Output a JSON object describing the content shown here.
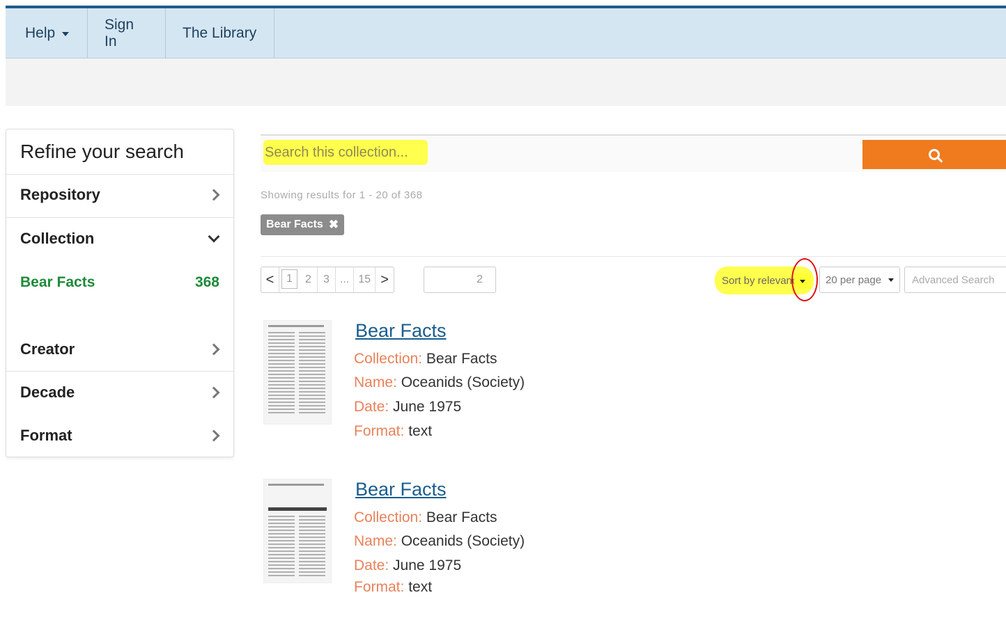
{
  "nav": {
    "help": "Help",
    "signin": "Sign In",
    "library": "The Library"
  },
  "sidebar": {
    "title": "Refine your search",
    "facets": [
      {
        "label": "Repository",
        "icon": "chevron-right-icon"
      },
      {
        "label": "Collection",
        "icon": "chevron-down-icon"
      },
      {
        "label": "Creator",
        "icon": "chevron-right-icon"
      },
      {
        "label": "Decade",
        "icon": "chevron-right-icon"
      },
      {
        "label": "Format",
        "icon": "chevron-right-icon"
      }
    ],
    "selected_value": {
      "label": "Bear Facts",
      "count": "368"
    }
  },
  "search": {
    "placeholder": "Search this collection...",
    "button_icon": "search-icon"
  },
  "results_summary": "Showing results for 1 - 20 of 368",
  "active_filter": {
    "label": "Bear Facts",
    "remove_icon": "close-icon"
  },
  "pagination": {
    "prev": "<",
    "pages": [
      "1",
      "2",
      "3",
      "...",
      "15"
    ],
    "next": ">",
    "jump_value": "2"
  },
  "controls": {
    "sort_label": "Sort by relevance",
    "per_page_label": "20 per page",
    "advanced_search": "Advanced Search"
  },
  "results": [
    {
      "title": "Bear Facts",
      "fields": [
        {
          "label": "Collection:",
          "value": "Bear Facts"
        },
        {
          "label": "Name:",
          "value": "Oceanids (Society)"
        },
        {
          "label": "Date:",
          "value": "June 1975"
        },
        {
          "label": "Format:",
          "value": "text"
        }
      ]
    },
    {
      "title": "Bear Facts",
      "fields": [
        {
          "label": "Collection:",
          "value": "Bear Facts"
        },
        {
          "label": "Name:",
          "value": "Oceanids (Society)"
        },
        {
          "label": "Date:",
          "value": "June 1975"
        },
        {
          "label": "Format:",
          "value": "text"
        }
      ]
    }
  ],
  "colors": {
    "accent_orange": "#ef7b1e",
    "link_blue": "#1a5d8e",
    "facet_green": "#1f8a3a",
    "highlight_yellow": "#ffff4d",
    "annotation_red": "#e01010"
  }
}
